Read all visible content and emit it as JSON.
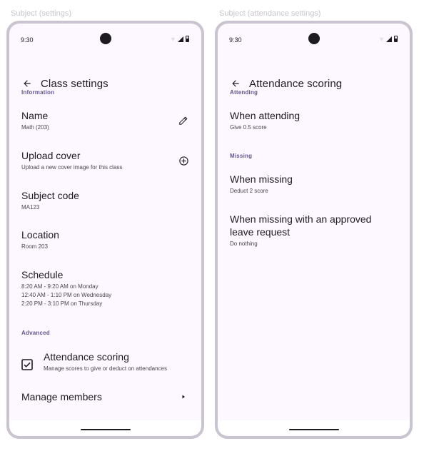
{
  "frames": [
    {
      "label": "Subject (settings)",
      "time": "9:30",
      "title": "Class settings",
      "sections": {
        "information": "Information",
        "advanced": "Advanced"
      },
      "items": {
        "name": {
          "headline": "Name",
          "support": "Math (203)",
          "icon": "pencil-icon"
        },
        "upload": {
          "headline": "Upload cover",
          "support": "Upload a new cover image for this class",
          "icon": "add-circle-icon"
        },
        "subject_code": {
          "headline": "Subject code",
          "support": "MA123"
        },
        "location": {
          "headline": "Location",
          "support": "Room 203"
        },
        "schedule": {
          "headline": "Schedule",
          "support": [
            "8:20 AM - 9:20 AM on Monday",
            "12:40 AM - 1:10 PM on Wednesday",
            "2:20 PM - 3:10 PM on Thursday"
          ]
        },
        "attendance": {
          "headline": "Attendance scoring",
          "support": "Manage scores to give or deduct on attendances",
          "checked": true
        },
        "members": {
          "headline": "Manage members",
          "icon": "chevron-right-icon"
        }
      }
    },
    {
      "label": "Subject (attendance settings)",
      "time": "9:30",
      "title": "Attendance scoring",
      "sections": {
        "attending": "Attending",
        "missing": "Missing"
      },
      "items": {
        "when_attending": {
          "headline": "When attending",
          "support": "Give 0.5 score"
        },
        "when_missing": {
          "headline": "When missing",
          "support": "Deduct 2 score"
        },
        "when_missing_leave": {
          "headline": "When missing with an approved leave request",
          "support": "Do nothing"
        }
      }
    }
  ],
  "colors": {
    "surface": "#fdf7ff",
    "frame": "#cac4d0",
    "section": "#65558f",
    "on_surface": "#1d1b20",
    "on_surface_variant": "#49454f"
  }
}
